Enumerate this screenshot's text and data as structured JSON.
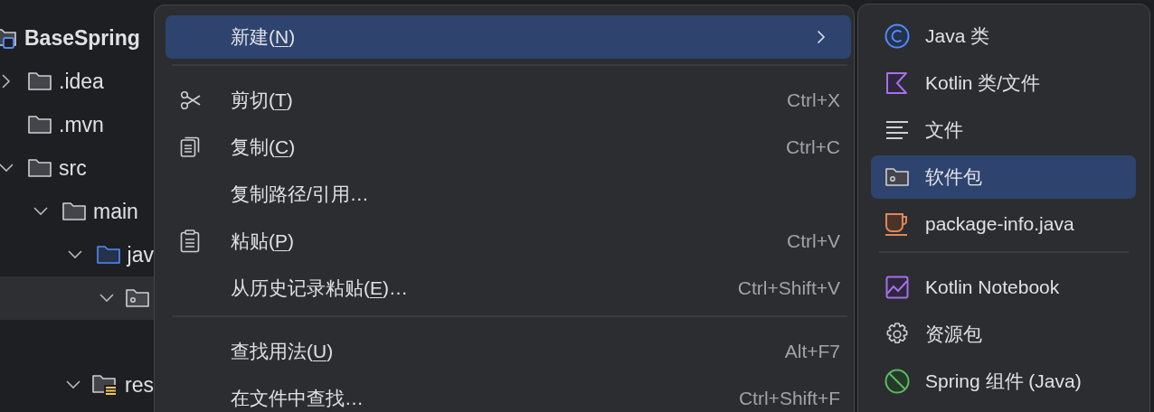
{
  "project_tree": [
    {
      "label": "BaseSpring",
      "kind": "project",
      "children": [
        {
          "label": ".idea",
          "kind": "folder",
          "expanded": false
        },
        {
          "label": ".mvn",
          "kind": "folder"
        },
        {
          "label": "src",
          "kind": "folder",
          "expanded": true,
          "children": [
            {
              "label": "main",
              "kind": "folder",
              "expanded": true,
              "children": [
                {
                  "label": "jav",
                  "kind": "source-folder",
                  "expanded": true,
                  "children": [
                    {
                      "kind": "package",
                      "expanded": true,
                      "selected": true
                    }
                  ]
                },
                {
                  "label": "res",
                  "kind": "resources",
                  "expanded": true
                }
              ]
            }
          ]
        }
      ]
    }
  ],
  "context_menu": [
    {
      "kind": "plain",
      "text_before": "新建(",
      "mnemonic": "N",
      "text_after": ")",
      "has_submenu": true,
      "selected": true
    },
    {
      "kind": "separator"
    },
    {
      "kind": "scissors",
      "text_before": "剪切(",
      "mnemonic": "T",
      "text_after": ")",
      "shortcut": "Ctrl+X",
      "selected": false
    },
    {
      "kind": "copy",
      "text_before": "复制(",
      "mnemonic": "C",
      "text_after": ")",
      "shortcut": "Ctrl+C",
      "selected": false
    },
    {
      "kind": "plain",
      "text_before": "复制路径/引用…",
      "selected": false
    },
    {
      "kind": "paste",
      "text_before": "粘贴(",
      "mnemonic": "P",
      "text_after": ")",
      "shortcut": "Ctrl+V",
      "selected": false
    },
    {
      "kind": "plain",
      "text_before": "从历史记录粘贴(",
      "mnemonic": "E",
      "text_after": ")…",
      "shortcut": "Ctrl+Shift+V",
      "selected": false
    },
    {
      "kind": "separator"
    },
    {
      "kind": "plain",
      "text_before": "查找用法(",
      "mnemonic": "U",
      "text_after": ")",
      "shortcut": "Alt+F7",
      "selected": false
    },
    {
      "kind": "plain",
      "text_before": "在文件中查找…",
      "shortcut": "Ctrl+Shift+F",
      "selected": false
    }
  ],
  "new_submenu": [
    {
      "kind": "java-class",
      "label": "Java 类",
      "selected": false
    },
    {
      "kind": "kotlin",
      "label": "Kotlin 类/文件",
      "selected": false
    },
    {
      "kind": "text-file",
      "label": "文件",
      "selected": false
    },
    {
      "kind": "package",
      "label": "软件包",
      "selected": true
    },
    {
      "kind": "cup",
      "label": "package-info.java",
      "selected": false
    },
    {
      "kind": "separator"
    },
    {
      "kind": "notebook",
      "label": "Kotlin Notebook",
      "selected": false
    },
    {
      "kind": "gear",
      "label": "资源包",
      "selected": false
    },
    {
      "kind": "spring",
      "label": "Spring 组件 (Java)",
      "selected": false
    }
  ]
}
